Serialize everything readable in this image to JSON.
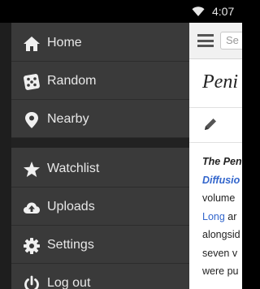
{
  "status_bar": {
    "time": "4:07",
    "wifi_icon": "wifi-icon"
  },
  "drawer": {
    "items": [
      {
        "label": "Home",
        "icon": "home-icon"
      },
      {
        "label": "Random",
        "icon": "dice-icon"
      },
      {
        "label": "Nearby",
        "icon": "map-pin-icon"
      },
      {
        "label": "Watchlist",
        "icon": "star-icon"
      },
      {
        "label": "Uploads",
        "icon": "cloud-upload-icon"
      },
      {
        "label": "Settings",
        "icon": "gear-icon"
      },
      {
        "label": "Log out",
        "icon": "power-icon"
      }
    ]
  },
  "article": {
    "search_placeholder": "Se",
    "title": "Peni",
    "lines": [
      {
        "part1": "The Pen",
        "part1_style": "bold-italic"
      },
      {
        "part1": "Diffusio",
        "part1_style": "bold-italic-link"
      },
      {
        "part1": "volume"
      },
      {
        "part1": "Long",
        "part1_style": "link",
        "part2": " ar"
      },
      {
        "part1": "alongsid"
      },
      {
        "part1": "seven v"
      },
      {
        "part1": "were pu"
      }
    ]
  },
  "colors": {
    "drawer_bg": "#3a3a3a",
    "drawer_text": "#e8e8e8",
    "link": "#3366cc",
    "status_bar_bg": "#000000"
  }
}
